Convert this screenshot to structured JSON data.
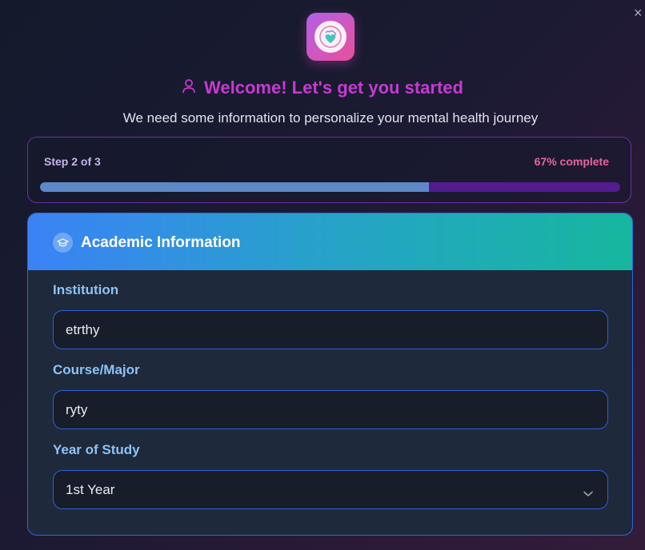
{
  "window": {
    "close_symbol": "×"
  },
  "header": {
    "logo_icon": "brain-heart-icon",
    "user_icon": "user-icon",
    "welcome_title": "Welcome! Let's get you started",
    "subtitle": "We need some information to personalize your mental health journey"
  },
  "progress": {
    "step_label": "Step 2 of 3",
    "percent_label": "67% complete",
    "fraction": 0.67
  },
  "academic": {
    "icon": "graduation-cap-icon",
    "title": "Academic Information",
    "institution": {
      "label": "Institution",
      "value": "etrthy"
    },
    "course": {
      "label": "Course/Major",
      "value": "ryty"
    },
    "year": {
      "label": "Year of Study",
      "value": "1st Year",
      "icon": "chevron-down-icon"
    }
  },
  "colors": {
    "accent_pink": "#c63ad0",
    "progress_fill": "#5e88c6",
    "progress_track": "#521c8f",
    "header_gradient_start": "#3b82f6",
    "header_gradient_end": "#16b79e"
  }
}
